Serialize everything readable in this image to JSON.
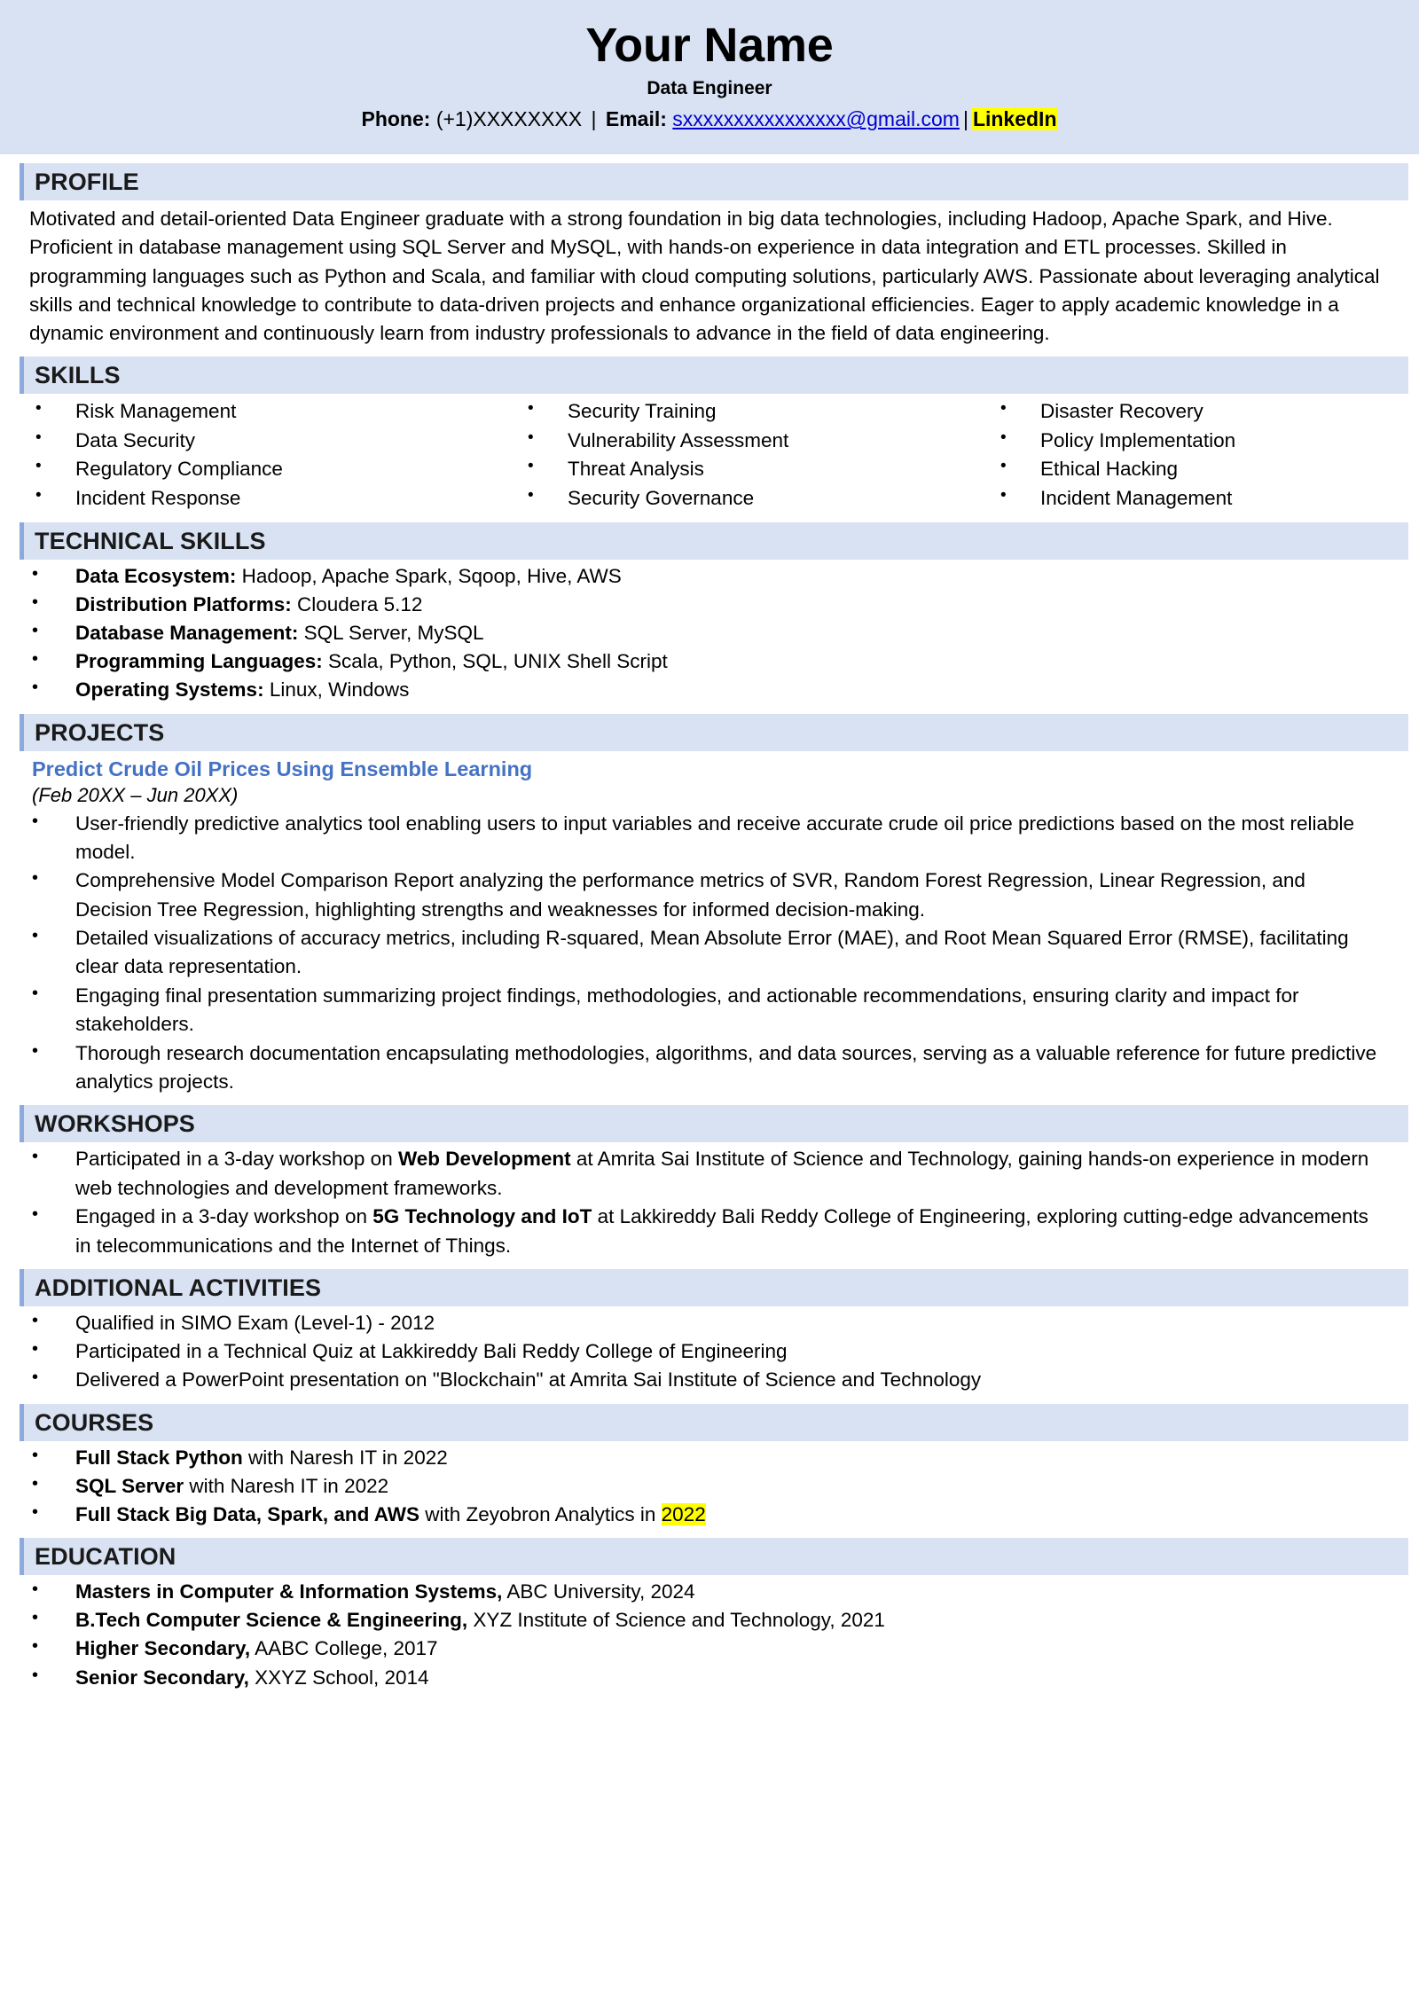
{
  "header": {
    "name": "Your Name",
    "role": "Data Engineer",
    "phone_label": "Phone:",
    "phone_value": " (+1)XXXXXXXX ",
    "sep1": "|",
    "email_label": " Email:",
    "email_value": "sxxxxxxxxxxxxxxxx@gmail.com",
    "sep2": "|",
    "linkedin_label": "LinkedIn"
  },
  "profile": {
    "title": "PROFILE",
    "text": "Motivated and detail-oriented Data Engineer graduate with a strong foundation in big data technologies, including Hadoop, Apache Spark, and Hive. Proficient in database management using SQL Server and MySQL, with hands-on experience in data integration and ETL processes. Skilled in programming languages such as Python and Scala, and familiar with cloud computing solutions, particularly AWS. Passionate about leveraging analytical skills and technical knowledge to contribute to data-driven projects and enhance organizational efficiencies. Eager to apply academic knowledge in a dynamic environment and continuously learn from industry professionals to advance in the field of data engineering."
  },
  "skills": {
    "title": "SKILLS",
    "col1": [
      "Risk Management",
      "Data Security",
      "Regulatory Compliance",
      "Incident Response"
    ],
    "col2": [
      "Security Training",
      "Vulnerability Assessment",
      "Threat Analysis",
      "Security Governance"
    ],
    "col3": [
      "Disaster Recovery",
      "Policy Implementation",
      "Ethical Hacking",
      "Incident Management"
    ]
  },
  "technical_skills": {
    "title": "TECHNICAL SKILLS",
    "items": [
      {
        "label": "Data Ecosystem:",
        "value": " Hadoop, Apache Spark, Sqoop, Hive, AWS"
      },
      {
        "label": "Distribution Platforms:",
        "value": " Cloudera 5.12"
      },
      {
        "label": "Database Management:",
        "value": " SQL Server, MySQL"
      },
      {
        "label": "Programming Languages:",
        "value": " Scala, Python, SQL, UNIX Shell Script"
      },
      {
        "label": "Operating Systems:",
        "value": " Linux, Windows"
      }
    ]
  },
  "projects": {
    "title": "PROJECTS",
    "project_title": "Predict Crude Oil Prices Using Ensemble Learning",
    "project_dates": "(Feb 20XX – Jun 20XX)",
    "bullets": [
      "User-friendly predictive analytics tool enabling users to input variables and receive accurate crude oil price predictions based on the most reliable model.",
      "Comprehensive Model Comparison Report analyzing the performance metrics of SVR, Random Forest Regression, Linear Regression, and Decision Tree Regression, highlighting strengths and weaknesses for informed decision-making.",
      "Detailed visualizations of accuracy metrics, including R-squared, Mean Absolute Error (MAE), and Root Mean Squared Error (RMSE), facilitating clear data representation.",
      "Engaging final presentation summarizing project findings, methodologies, and actionable recommendations, ensuring clarity and impact for stakeholders.",
      "Thorough research documentation encapsulating methodologies, algorithms, and data sources, serving as a valuable reference for future predictive analytics projects."
    ]
  },
  "workshops": {
    "title": "WORKSHOPS",
    "items": [
      {
        "pre": "Participated in a 3-day workshop on ",
        "bold": "Web Development",
        "post": " at Amrita Sai Institute of Science and Technology, gaining hands-on experience in modern web technologies and development frameworks."
      },
      {
        "pre": "Engaged in a 3-day workshop on ",
        "bold": "5G Technology and IoT",
        "post": " at Lakkireddy Bali Reddy College of Engineering, exploring cutting-edge advancements in telecommunications and the Internet of Things."
      }
    ]
  },
  "additional_activities": {
    "title": "ADDITIONAL ACTIVITIES",
    "items": [
      "Qualified in SIMO Exam (Level-1) - 2012",
      "Participated in a Technical Quiz at Lakkireddy Bali Reddy College of Engineering",
      "Delivered a PowerPoint presentation on \"Blockchain\" at Amrita Sai Institute of Science and Technology"
    ]
  },
  "courses": {
    "title": "COURSES",
    "items": [
      {
        "bold": "Full Stack Python",
        "rest": " with Naresh IT in 2022",
        "highlight": ""
      },
      {
        "bold": "SQL Server",
        "rest": " with Naresh IT in 2022",
        "highlight": ""
      },
      {
        "bold": "Full Stack Big Data, Spark, and AWS",
        "rest": " with Zeyobron Analytics in ",
        "highlight": "2022"
      }
    ]
  },
  "education": {
    "title": "EDUCATION",
    "items": [
      {
        "bold": "Masters in Computer & Information Systems,",
        "rest": " ABC University, 2024"
      },
      {
        "bold": "B.Tech Computer Science & Engineering,",
        "rest": " XYZ Institute of Science and Technology, 2021"
      },
      {
        "bold": "Higher Secondary,",
        "rest": " AABC College, 2017"
      },
      {
        "bold": "Senior Secondary,",
        "rest": " XXYZ School, 2014"
      }
    ]
  },
  "colors": {
    "banner_bg": "#d9e2f3",
    "section_bg": "#d9e2f3",
    "accent_bar": "#8ea9db",
    "project_title": "#4472c4",
    "link": "#0000d0",
    "highlight": "#ffff00"
  }
}
